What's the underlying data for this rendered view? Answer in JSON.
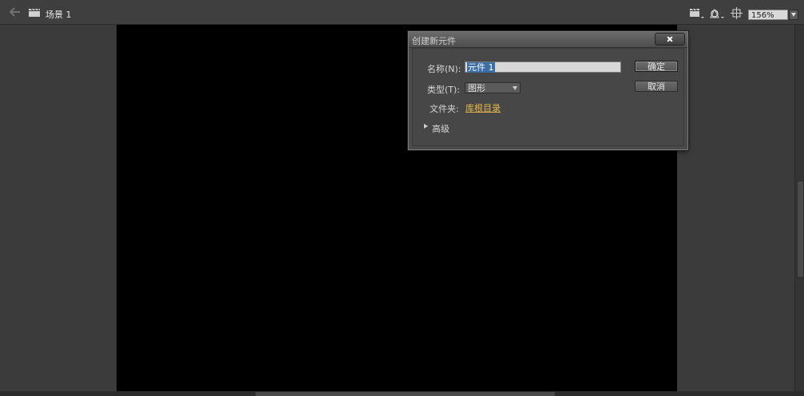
{
  "editbar": {
    "scene_label": "场景 1",
    "zoom_value": "156%",
    "icons": [
      "back-arrow-icon",
      "scene-clapper-icon",
      "edit-scene-icon",
      "edit-symbol-icon",
      "center-stage-icon",
      "zoom-dropdown-icon"
    ]
  },
  "dialog": {
    "title": "创建新元件",
    "name_label": "名称(N):",
    "name_value": "元件 1",
    "type_label": "类型(T):",
    "type_value": "图形",
    "folder_label": "文件夹:",
    "folder_value": "库根目录",
    "advanced_label": "高级",
    "ok_label": "确定",
    "cancel_label": "取消"
  },
  "colors": {
    "stage": "#000000",
    "pasteboard": "#3b3b3b",
    "folder_link": "#e8b84a"
  }
}
